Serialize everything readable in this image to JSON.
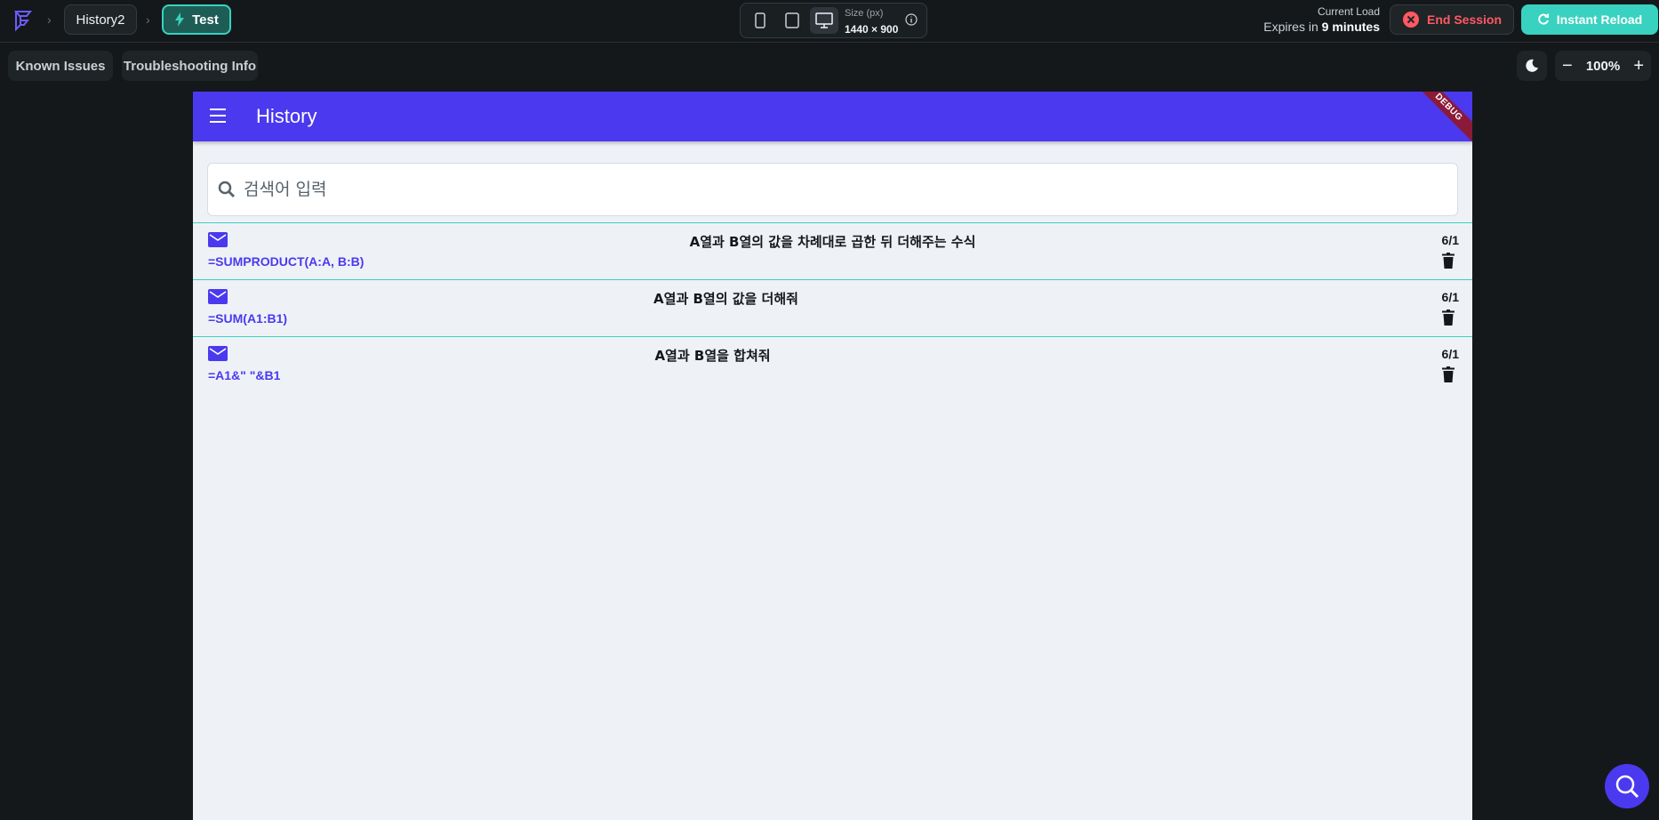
{
  "topbar": {
    "project_name": "History2",
    "test_label": "Test",
    "size_label": "Size (px)",
    "size_value": "1440 × 900",
    "current_load_label": "Current Load",
    "expires_prefix": "Expires in",
    "expires_value": "9 minutes",
    "end_session_label": "End Session",
    "instant_reload_label": "Instant Reload"
  },
  "toolbar": {
    "known_issues_label": "Known Issues",
    "troubleshooting_label": "Troubleshooting Info",
    "zoom_value": "100%",
    "zoom_minus": "−",
    "zoom_plus": "+"
  },
  "app": {
    "title": "History",
    "debug_label": "DEBUG",
    "search_placeholder": "검색어 입력",
    "items": [
      {
        "title": "A열과 B열의 값을 차례대로 곱한 뒤 더해주는 수식",
        "formula": "=SUMPRODUCT(A:A, B:B)",
        "date": "6/1"
      },
      {
        "title": "A열과 B열의 값을 더해줘",
        "formula": "=SUM(A1:B1)",
        "date": "6/1"
      },
      {
        "title": "A열과 B열을 합쳐줘",
        "formula": "=A1&\" \"&B1",
        "date": "6/1"
      }
    ]
  },
  "colors": {
    "primary": "#4b39ef",
    "accent": "#39d2c0",
    "danger": "#ff5963",
    "background": "#14181b"
  }
}
